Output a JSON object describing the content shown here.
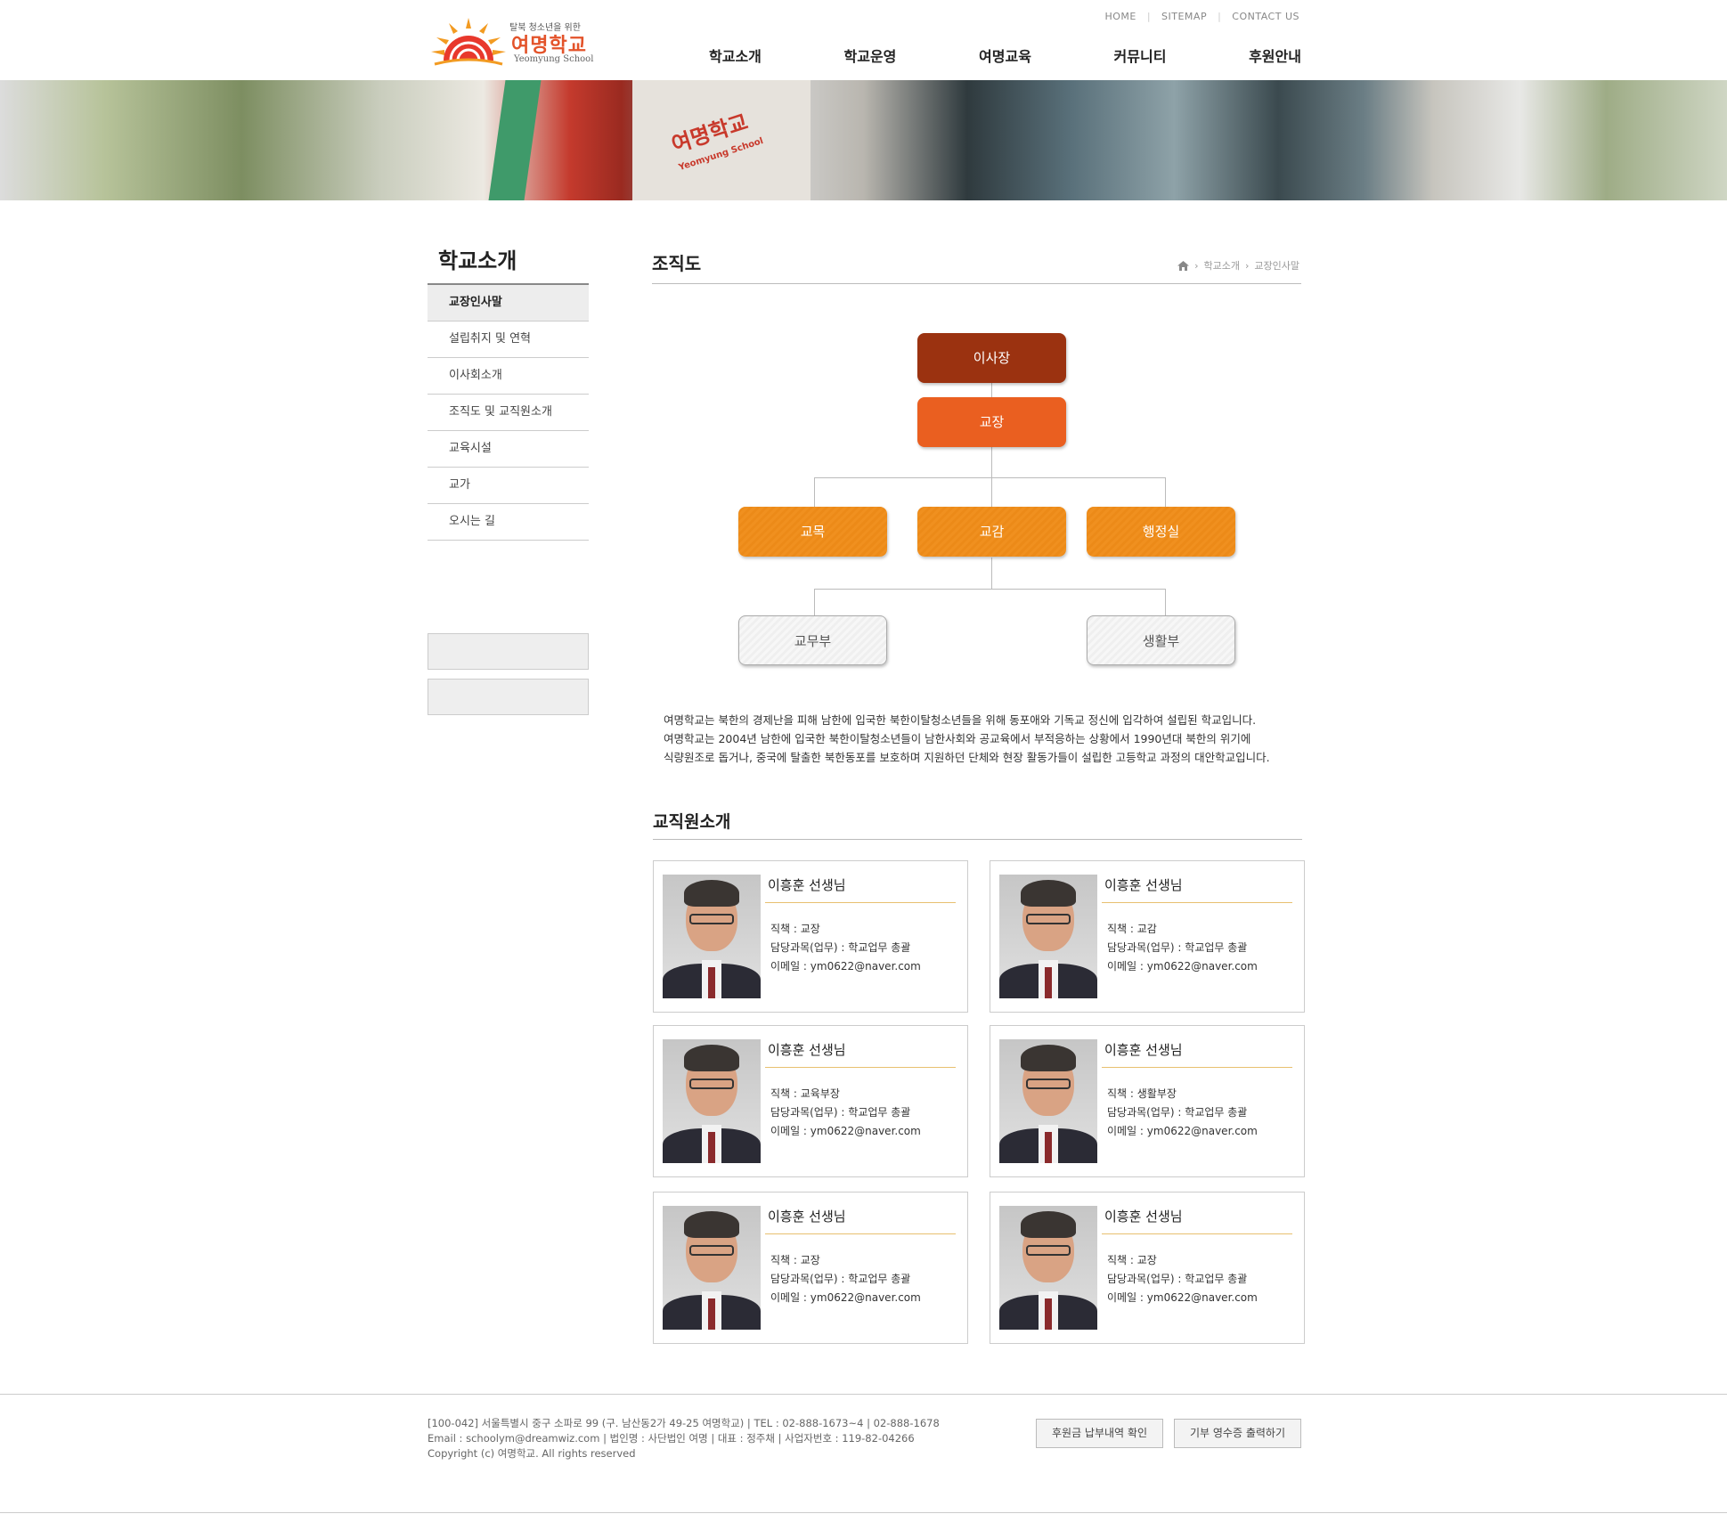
{
  "header": {
    "logo_tagline": "탈북 청소년을 위한",
    "logo_name": "여명학교",
    "logo_english": "Yeomyung School",
    "util_links": [
      "HOME",
      "SITEMAP",
      "CONTACT US"
    ],
    "gnb": [
      "학교소개",
      "학교운영",
      "여명교육",
      "커뮤니티",
      "후원안내"
    ]
  },
  "banner": {
    "sign_kr": "여명학교",
    "sign_en": "Yeomyung School"
  },
  "sidebar": {
    "title": "학교소개",
    "items": [
      "교장인사말",
      "설립취지 및 연혁",
      "이사회소개",
      "조직도 및 교직원소개",
      "교육시설",
      "교가",
      "오시는 길"
    ]
  },
  "main": {
    "title": "조직도",
    "breadcrumb": [
      "학교소개",
      "교장인사말"
    ],
    "org": {
      "chairman": "이사장",
      "principal": "교장",
      "level2": [
        "교목",
        "교감",
        "행정실"
      ],
      "level3": [
        "교무부",
        "생활부"
      ]
    },
    "description": [
      "여명학교는 북한의 경제난을 피해 남한에 입국한 북한이탈청소년들을 위해 동포애와 기독교 정신에 입각하여 설립된 학교입니다.",
      "여명학교는 2004년 남한에 입국한 북한이탈청소년들이 남한사회와 공교육에서 부적응하는 상황에서 1990년대 북한의 위기에",
      "식량원조로 돕거나, 중국에 탈출한 북한동포를 보호하며 지원하던 단체와 현장 활동가들이 설립한 고등학교 과정의 대안학교입니다."
    ],
    "staff_title": "교직원소개",
    "staff": [
      {
        "name": "이흥훈 선생님",
        "role": "직책 : 교장",
        "subject": "담당과목(업무) : 학교업무 총괄",
        "email": "이메일 : ym0622@naver.com"
      },
      {
        "name": "이흥훈 선생님",
        "role": "직책 : 교감",
        "subject": "담당과목(업무) : 학교업무 총괄",
        "email": "이메일 : ym0622@naver.com"
      },
      {
        "name": "이흥훈 선생님",
        "role": "직책 : 교육부장",
        "subject": "담당과목(업무) : 학교업무 총괄",
        "email": "이메일 : ym0622@naver.com"
      },
      {
        "name": "이흥훈 선생님",
        "role": "직책 : 생활부장",
        "subject": "담당과목(업무) : 학교업무 총괄",
        "email": "이메일 : ym0622@naver.com"
      },
      {
        "name": "이흥훈 선생님",
        "role": "직책 : 교장",
        "subject": "담당과목(업무) : 학교업무 총괄",
        "email": "이메일 : ym0622@naver.com"
      },
      {
        "name": "이흥훈 선생님",
        "role": "직책 : 교장",
        "subject": "담당과목(업무) : 학교업무 총괄",
        "email": "이메일 : ym0622@naver.com"
      }
    ]
  },
  "footer": {
    "address": "[100-042] 서울특별시 중구 소파로 99 (구. 남산동2가 49-25 여명학교) | TEL : 02-888-1673~4 | 02-888-1678",
    "email": "Email : schoolym@dreamwiz.com | 법인명 : 사단법인 여명 | 대표 : 정주채 | 사업자번호 : 119-82-04266",
    "copyright": "Copyright (c) 여명학교. All rights reserved",
    "button1": "후원금 납부내역 확인",
    "button2": "기부 영수증 출력하기"
  },
  "colors": {
    "accent_dark": "#9b3210",
    "accent_red": "#ea5f20",
    "accent_orange": "#f0901f"
  }
}
